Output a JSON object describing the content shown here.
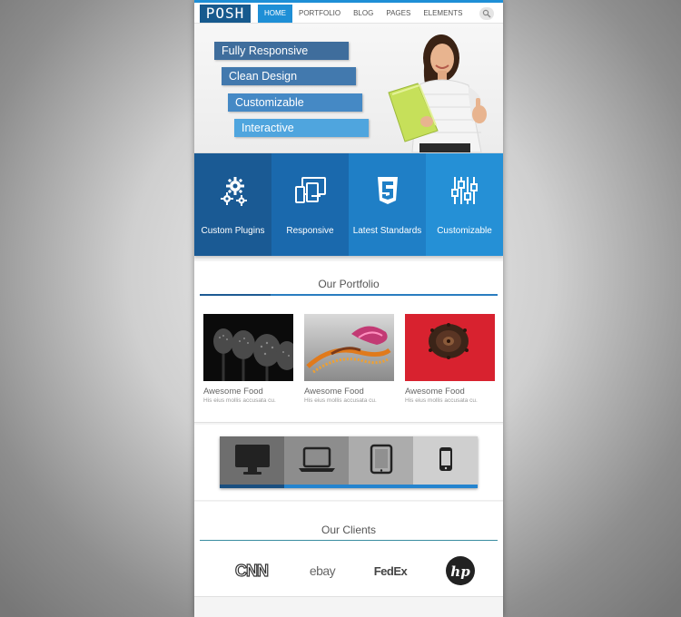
{
  "header": {
    "logo": "POSH",
    "nav": [
      "HOME",
      "PORTFOLIO",
      "BLOG",
      "PAGES",
      "ELEMENTS"
    ],
    "active_nav": "HOME"
  },
  "hero": {
    "features": [
      "Fully Responsive",
      "Clean Design",
      "Customizable",
      "Interactive"
    ]
  },
  "services": [
    {
      "label": "Custom Plugins",
      "icon": "gears-icon"
    },
    {
      "label": "Responsive",
      "icon": "devices-icon"
    },
    {
      "label": "Latest Standards",
      "icon": "html5-icon"
    },
    {
      "label": "Customizable",
      "icon": "sliders-icon"
    }
  ],
  "portfolio": {
    "title": "Our Portfolio",
    "items": [
      {
        "title": "Awesome Food",
        "subtitle": "His eius mollis accusata cu."
      },
      {
        "title": "Awesome Food",
        "subtitle": "His eius mollis accusata cu."
      },
      {
        "title": "Awesome Food",
        "subtitle": "His eius mollis accusata cu."
      }
    ]
  },
  "devices": [
    "desktop-icon",
    "laptop-icon",
    "tablet-icon",
    "phone-icon"
  ],
  "clients": {
    "title": "Our Clients",
    "logos": [
      "CNN",
      "ebay",
      "FedEx",
      "hp"
    ]
  },
  "colors": {
    "accent": "#1e8fd6",
    "dark_blue": "#175a8e"
  }
}
